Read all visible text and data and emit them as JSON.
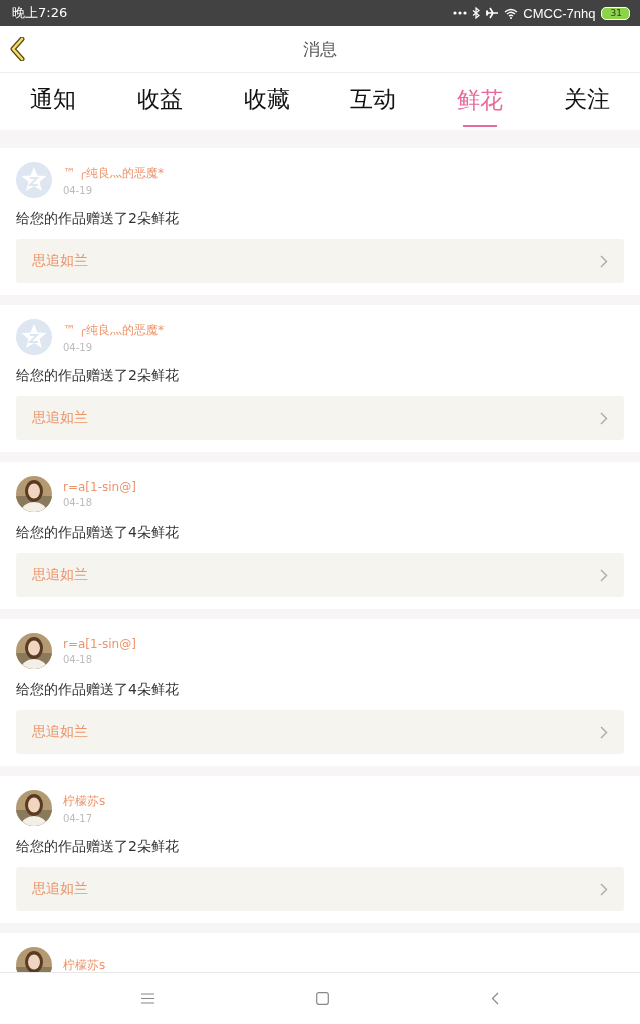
{
  "status_bar": {
    "time": "晚上7:26",
    "carrier": "CMCC-7nhq",
    "battery": "31"
  },
  "header": {
    "title": "消息"
  },
  "tabs": [
    {
      "label": "通知",
      "selected": false
    },
    {
      "label": "收益",
      "selected": false
    },
    {
      "label": "收藏",
      "selected": false
    },
    {
      "label": "互动",
      "selected": false
    },
    {
      "label": "鲜花",
      "selected": true
    },
    {
      "label": "关注",
      "selected": false
    }
  ],
  "messages": [
    {
      "avatar": {
        "kind": "default"
      },
      "name": "™ ╭纯良灬的恶魔*",
      "date": "04-19",
      "text": "给您的作品赠送了2朵鲜花",
      "work": "思追如兰"
    },
    {
      "avatar": {
        "kind": "default"
      },
      "name": "™ ╭纯良灬的恶魔*",
      "date": "04-19",
      "text": "给您的作品赠送了2朵鲜花",
      "work": "思追如兰"
    },
    {
      "name": "r=a[1-sin@]",
      "date": "04-18",
      "text": "给您的作品赠送了4朵鲜花",
      "work": "思追如兰"
    },
    {
      "name": "r=a[1-sin@]",
      "date": "04-18",
      "text": "给您的作品赠送了4朵鲜花",
      "work": "思追如兰"
    },
    {
      "name": "柠檬苏s",
      "date": "04-17",
      "text": "给您的作品赠送了2朵鲜花",
      "work": "思追如兰"
    },
    {
      "name": "柠檬苏s"
    }
  ]
}
